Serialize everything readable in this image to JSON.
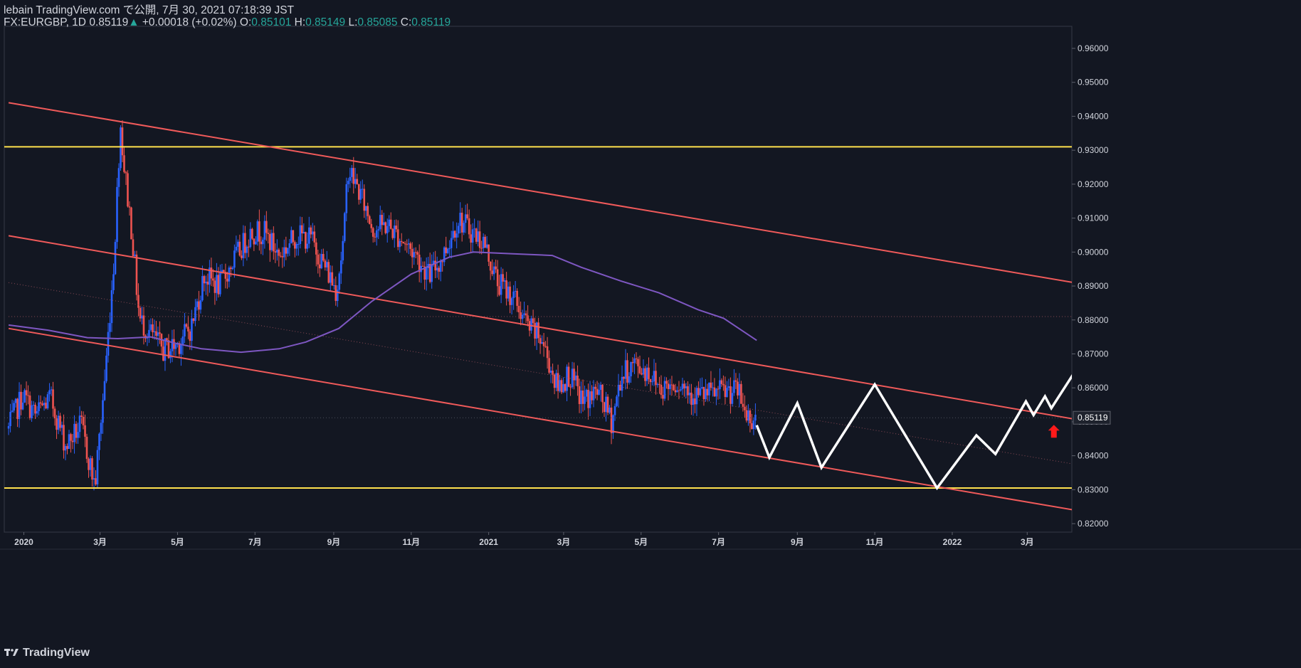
{
  "header": {
    "line1": "lebain TradingView.com で公開, 7月 30, 2021 07:18:39 JST",
    "symbol": "FX:EURGBP, 1D",
    "price": "0.85119",
    "arrow": "▲",
    "change": "+0.00018 (+0.02%)",
    "o_label": "O:",
    "o_value": "0.85101",
    "h_label": "H:",
    "h_value": "0.85149",
    "l_label": "L:",
    "l_value": "0.85085",
    "c_label": "C:",
    "c_value": "0.85119"
  },
  "brand": {
    "name": "TradingView",
    "icon": "tradingview-logo-icon"
  },
  "colors": {
    "background": "#131722",
    "up": "#2962ff",
    "down": "#ef5350",
    "channel": "#f05a5a",
    "support": "#ffe14d",
    "moving_average": "#7e57c2",
    "projection": "#ffffff",
    "marker": "#ff1a1a",
    "axis_text": "#d1d4dc"
  },
  "chart_data": {
    "type": "candlestick",
    "symbol": "FX:EURGBP",
    "interval": "1D",
    "last_price": "0.85119",
    "ylim": [
      0.8175,
      0.9665
    ],
    "y_ticks": [
      "0.96000",
      "0.95000",
      "0.94000",
      "0.93000",
      "0.92000",
      "0.91000",
      "0.90000",
      "0.89000",
      "0.88000",
      "0.87000",
      "0.86000",
      "0.85000",
      "0.84000",
      "0.83000",
      "0.82000"
    ],
    "x_ticks": [
      {
        "label": "2020",
        "date": "2020-01-01"
      },
      {
        "label": "3月",
        "date": "2020-03-01"
      },
      {
        "label": "5月",
        "date": "2020-05-01"
      },
      {
        "label": "7月",
        "date": "2020-07-01"
      },
      {
        "label": "9月",
        "date": "2020-09-01"
      },
      {
        "label": "11月",
        "date": "2020-11-01"
      },
      {
        "label": "2021",
        "date": "2021-01-01"
      },
      {
        "label": "3月",
        "date": "2021-03-01"
      },
      {
        "label": "5月",
        "date": "2021-05-01"
      },
      {
        "label": "7月",
        "date": "2021-07-01"
      },
      {
        "label": "9月",
        "date": "2021-09-01"
      },
      {
        "label": "11月",
        "date": "2021-11-01"
      },
      {
        "label": "2022",
        "date": "2022-01-01"
      },
      {
        "label": "3月",
        "date": "2022-03-01"
      }
    ],
    "close_path": [
      [
        "2019-12-20",
        0.848
      ],
      [
        "2019-12-31",
        0.858
      ],
      [
        "2020-01-10",
        0.852
      ],
      [
        "2020-01-22",
        0.857
      ],
      [
        "2020-02-03",
        0.843
      ],
      [
        "2020-02-15",
        0.849
      ],
      [
        "2020-02-26",
        0.831
      ],
      [
        "2020-03-05",
        0.864
      ],
      [
        "2020-03-12",
        0.898
      ],
      [
        "2020-03-17",
        0.938
      ],
      [
        "2020-03-20",
        0.925
      ],
      [
        "2020-03-26",
        0.906
      ],
      [
        "2020-04-01",
        0.88
      ],
      [
        "2020-04-10",
        0.876
      ],
      [
        "2020-04-20",
        0.871
      ],
      [
        "2020-05-01",
        0.873
      ],
      [
        "2020-05-12",
        0.878
      ],
      [
        "2020-05-22",
        0.893
      ],
      [
        "2020-06-03",
        0.89
      ],
      [
        "2020-06-15",
        0.898
      ],
      [
        "2020-06-28",
        0.906
      ],
      [
        "2020-07-08",
        0.906
      ],
      [
        "2020-07-20",
        0.899
      ],
      [
        "2020-08-03",
        0.905
      ],
      [
        "2020-08-14",
        0.904
      ],
      [
        "2020-08-26",
        0.895
      ],
      [
        "2020-09-03",
        0.889
      ],
      [
        "2020-09-09",
        0.904
      ],
      [
        "2020-09-12",
        0.925
      ],
      [
        "2020-09-22",
        0.917
      ],
      [
        "2020-10-02",
        0.907
      ],
      [
        "2020-10-13",
        0.908
      ],
      [
        "2020-10-24",
        0.904
      ],
      [
        "2020-11-05",
        0.899
      ],
      [
        "2020-11-15",
        0.893
      ],
      [
        "2020-11-25",
        0.898
      ],
      [
        "2020-12-08",
        0.91
      ],
      [
        "2020-12-16",
        0.907
      ],
      [
        "2020-12-28",
        0.903
      ],
      [
        "2021-01-08",
        0.891
      ],
      [
        "2021-01-20",
        0.887
      ],
      [
        "2021-02-01",
        0.878
      ],
      [
        "2021-02-12",
        0.874
      ],
      [
        "2021-02-24",
        0.86
      ],
      [
        "2021-03-05",
        0.864
      ],
      [
        "2021-03-16",
        0.856
      ],
      [
        "2021-03-28",
        0.859
      ],
      [
        "2021-04-08",
        0.85
      ],
      [
        "2021-04-15",
        0.863
      ],
      [
        "2021-04-25",
        0.867
      ],
      [
        "2021-05-06",
        0.865
      ],
      [
        "2021-05-17",
        0.86
      ],
      [
        "2021-05-30",
        0.862
      ],
      [
        "2021-06-12",
        0.858
      ],
      [
        "2021-06-24",
        0.858
      ],
      [
        "2021-07-06",
        0.859
      ],
      [
        "2021-07-16",
        0.859
      ],
      [
        "2021-07-23",
        0.852
      ],
      [
        "2021-07-30",
        0.851
      ]
    ],
    "moving_average": [
      [
        "2019-12-20",
        0.8785
      ],
      [
        "2020-01-20",
        0.877
      ],
      [
        "2020-02-20",
        0.8748
      ],
      [
        "2020-03-15",
        0.8745
      ],
      [
        "2020-04-10",
        0.875
      ],
      [
        "2020-05-01",
        0.873
      ],
      [
        "2020-05-20",
        0.8715
      ],
      [
        "2020-06-20",
        0.8705
      ],
      [
        "2020-07-20",
        0.8715
      ],
      [
        "2020-08-10",
        0.8735
      ],
      [
        "2020-09-05",
        0.8775
      ],
      [
        "2020-10-01",
        0.8855
      ],
      [
        "2020-11-01",
        0.8935
      ],
      [
        "2020-12-01",
        0.8985
      ],
      [
        "2020-12-20",
        0.9
      ],
      [
        "2021-01-20",
        0.8995
      ],
      [
        "2021-02-20",
        0.899
      ],
      [
        "2021-03-15",
        0.8955
      ],
      [
        "2021-04-15",
        0.8915
      ],
      [
        "2021-05-15",
        0.888
      ],
      [
        "2021-06-15",
        0.883
      ],
      [
        "2021-07-05",
        0.8805
      ],
      [
        "2021-07-31",
        0.874
      ]
    ],
    "channel_lines": [
      {
        "name": "upper",
        "points": [
          [
            "2019-12-20",
            0.944
          ],
          [
            "2022-04-15",
            0.8905
          ]
        ]
      },
      {
        "name": "middle",
        "points": [
          [
            "2019-12-20",
            0.9048
          ],
          [
            "2022-04-15",
            0.8503
          ]
        ]
      },
      {
        "name": "lower",
        "points": [
          [
            "2019-12-20",
            0.8775
          ],
          [
            "2022-04-15",
            0.8235
          ]
        ]
      }
    ],
    "dotted_lines": [
      {
        "name": "midline",
        "points": [
          [
            "2019-12-20",
            0.891
          ],
          [
            "2022-04-15",
            0.837
          ]
        ]
      },
      {
        "name": "level",
        "points": [
          [
            "2019-12-20",
            0.881
          ],
          [
            "2022-04-15",
            0.881
          ]
        ]
      }
    ],
    "horizontal_levels": [
      0.931,
      0.8305
    ],
    "projection_path": [
      [
        "2021-07-31",
        0.849
      ],
      [
        "2021-08-10",
        0.8395
      ],
      [
        "2021-09-01",
        0.8555
      ],
      [
        "2021-09-20",
        0.8365
      ],
      [
        "2021-11-01",
        0.861
      ],
      [
        "2021-12-20",
        0.8305
      ],
      [
        "2022-01-20",
        0.846
      ],
      [
        "2022-02-04",
        0.8405
      ],
      [
        "2022-02-28",
        0.856
      ],
      [
        "2022-03-06",
        0.852
      ],
      [
        "2022-03-15",
        0.8575
      ],
      [
        "2022-03-20",
        0.854
      ],
      [
        "2022-04-20",
        0.872
      ]
    ],
    "marker": {
      "type": "up-arrow",
      "date": "2022-03-22",
      "value": 0.847
    }
  }
}
